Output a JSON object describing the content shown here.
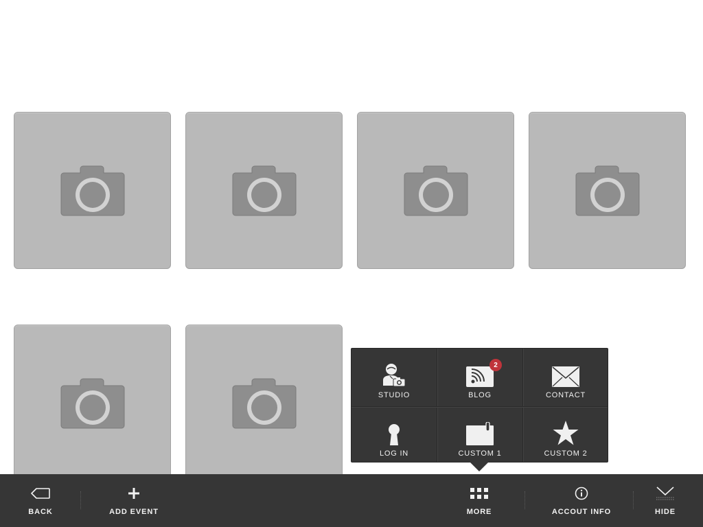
{
  "grid": {
    "tiles": [
      {
        "icon": "camera-icon"
      },
      {
        "icon": "camera-icon"
      },
      {
        "icon": "camera-icon"
      },
      {
        "icon": "camera-icon"
      },
      {
        "icon": "camera-icon"
      },
      {
        "icon": "camera-icon"
      }
    ]
  },
  "more_menu": {
    "items": [
      {
        "label": "STUDIO",
        "icon": "photographer-icon"
      },
      {
        "label": "BLOG",
        "icon": "rss-icon",
        "badge": "2"
      },
      {
        "label": "CONTACT",
        "icon": "envelope-icon"
      },
      {
        "label": "LOG IN",
        "icon": "keyhole-icon"
      },
      {
        "label": "CUSTOM 1",
        "icon": "clipboard-icon"
      },
      {
        "label": "CUSTOM 2",
        "icon": "star-icon"
      }
    ]
  },
  "toolbar": {
    "back_label": "BACK",
    "add_event_label": "ADD EVENT",
    "more_label": "MORE",
    "account_info_label": "ACCOUT INFO",
    "hide_label": "HIDE"
  },
  "colors": {
    "toolbar_bg": "#363636",
    "tile_bg": "#b9b9b9",
    "camera": "#8e8e8e",
    "badge": "#c0343b"
  }
}
